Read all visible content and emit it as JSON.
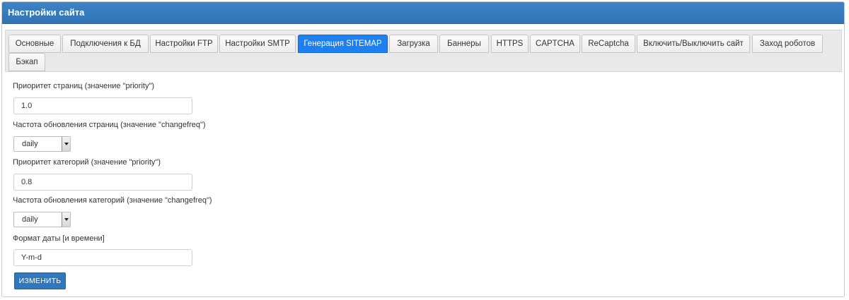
{
  "panel": {
    "title": "Настройки сайта"
  },
  "tabs": [
    {
      "label": "Основные",
      "active": false
    },
    {
      "label": "Подключения к БД",
      "active": false
    },
    {
      "label": "Настройки FTP",
      "active": false
    },
    {
      "label": "Настройки SMTP",
      "active": false
    },
    {
      "label": "Генерация SITEMAP",
      "active": true
    },
    {
      "label": "Загрузка",
      "active": false
    },
    {
      "label": "Баннеры",
      "active": false
    },
    {
      "label": "HTTPS",
      "active": false
    },
    {
      "label": "CAPTCHA",
      "active": false
    },
    {
      "label": "ReCaptcha",
      "active": false
    },
    {
      "label": "Включить/Выключить сайт",
      "active": false
    },
    {
      "label": "Заход роботов",
      "active": false
    },
    {
      "label": "Бэкап",
      "active": false
    }
  ],
  "form": {
    "pages_priority": {
      "label": "Приоритет страниц (значение \"priority\")",
      "value": "1.0"
    },
    "pages_changefreq": {
      "label": "Частота обновления страниц (значение \"changefreq\")",
      "value": "daily"
    },
    "categories_priority": {
      "label": "Приоритет категорий (значение \"priority\")",
      "value": "0.8"
    },
    "categories_changefreq": {
      "label": "Частота обновления категорий (значение \"changefreq\")",
      "value": "daily"
    },
    "date_format": {
      "label": "Формат даты [и времени]",
      "value": "Y-m-d"
    },
    "submit_label": "ИЗМЕНИТЬ"
  },
  "colors": {
    "header": "#2f73b4",
    "active_tab": "#1c7ff2",
    "submit_button": "#3277bc"
  }
}
